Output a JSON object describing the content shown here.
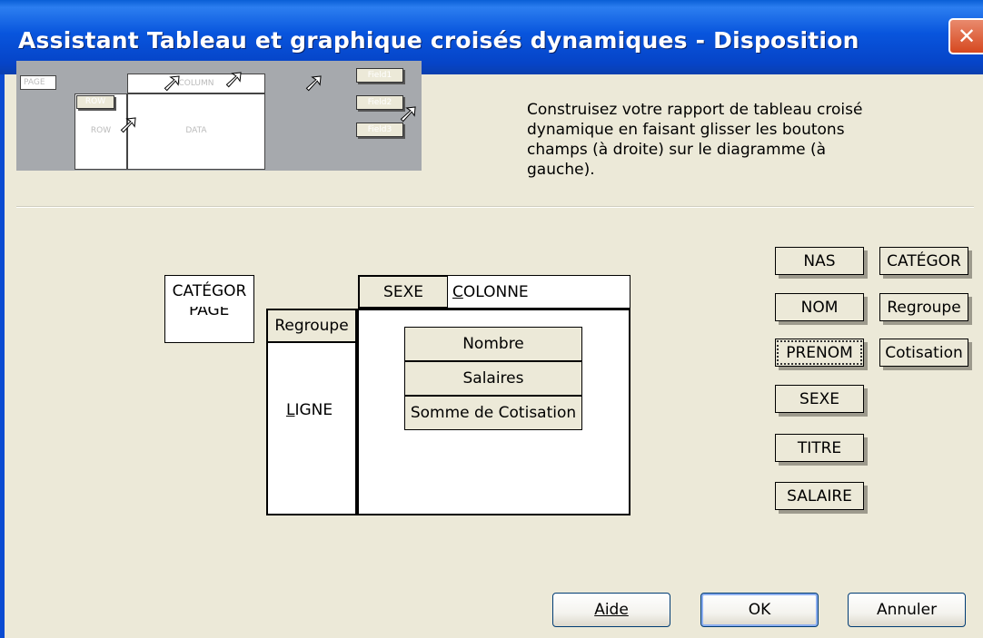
{
  "window": {
    "title": "Assistant Tableau et graphique croisés dynamiques - Disposition",
    "close_glyph": "✕"
  },
  "preview": {
    "page_label": "PAGE",
    "row_label": "ROW",
    "column_label": "COLUMN",
    "data_label": "DATA",
    "row_area_label": "ROW",
    "field_buttons": [
      "Field1",
      "Field2",
      "Field3"
    ]
  },
  "instructions": "Construisez votre rapport de tableau croisé dynamique en faisant glisser les boutons champs (à droite) sur le diagramme (à gauche).",
  "layout": {
    "page_field": "CATÉGOR",
    "page_label": "PAGE",
    "column_field": "SEXE",
    "column_label": "COLONNE",
    "row_field": "Regroupe",
    "row_label": "LIGNE",
    "data_fields": [
      "Nombre",
      "Salaires",
      "Somme de Cotisation"
    ]
  },
  "fields": {
    "col1": [
      "NAS",
      "NOM",
      "PRENOM",
      "SEXE",
      "TITRE",
      "SALAIRE"
    ],
    "col2": [
      "CATÉGOR",
      "Regroupe",
      "Cotisation"
    ],
    "focused": "PRENOM"
  },
  "buttons": {
    "help": "Aide",
    "ok": "OK",
    "cancel": "Annuler"
  }
}
